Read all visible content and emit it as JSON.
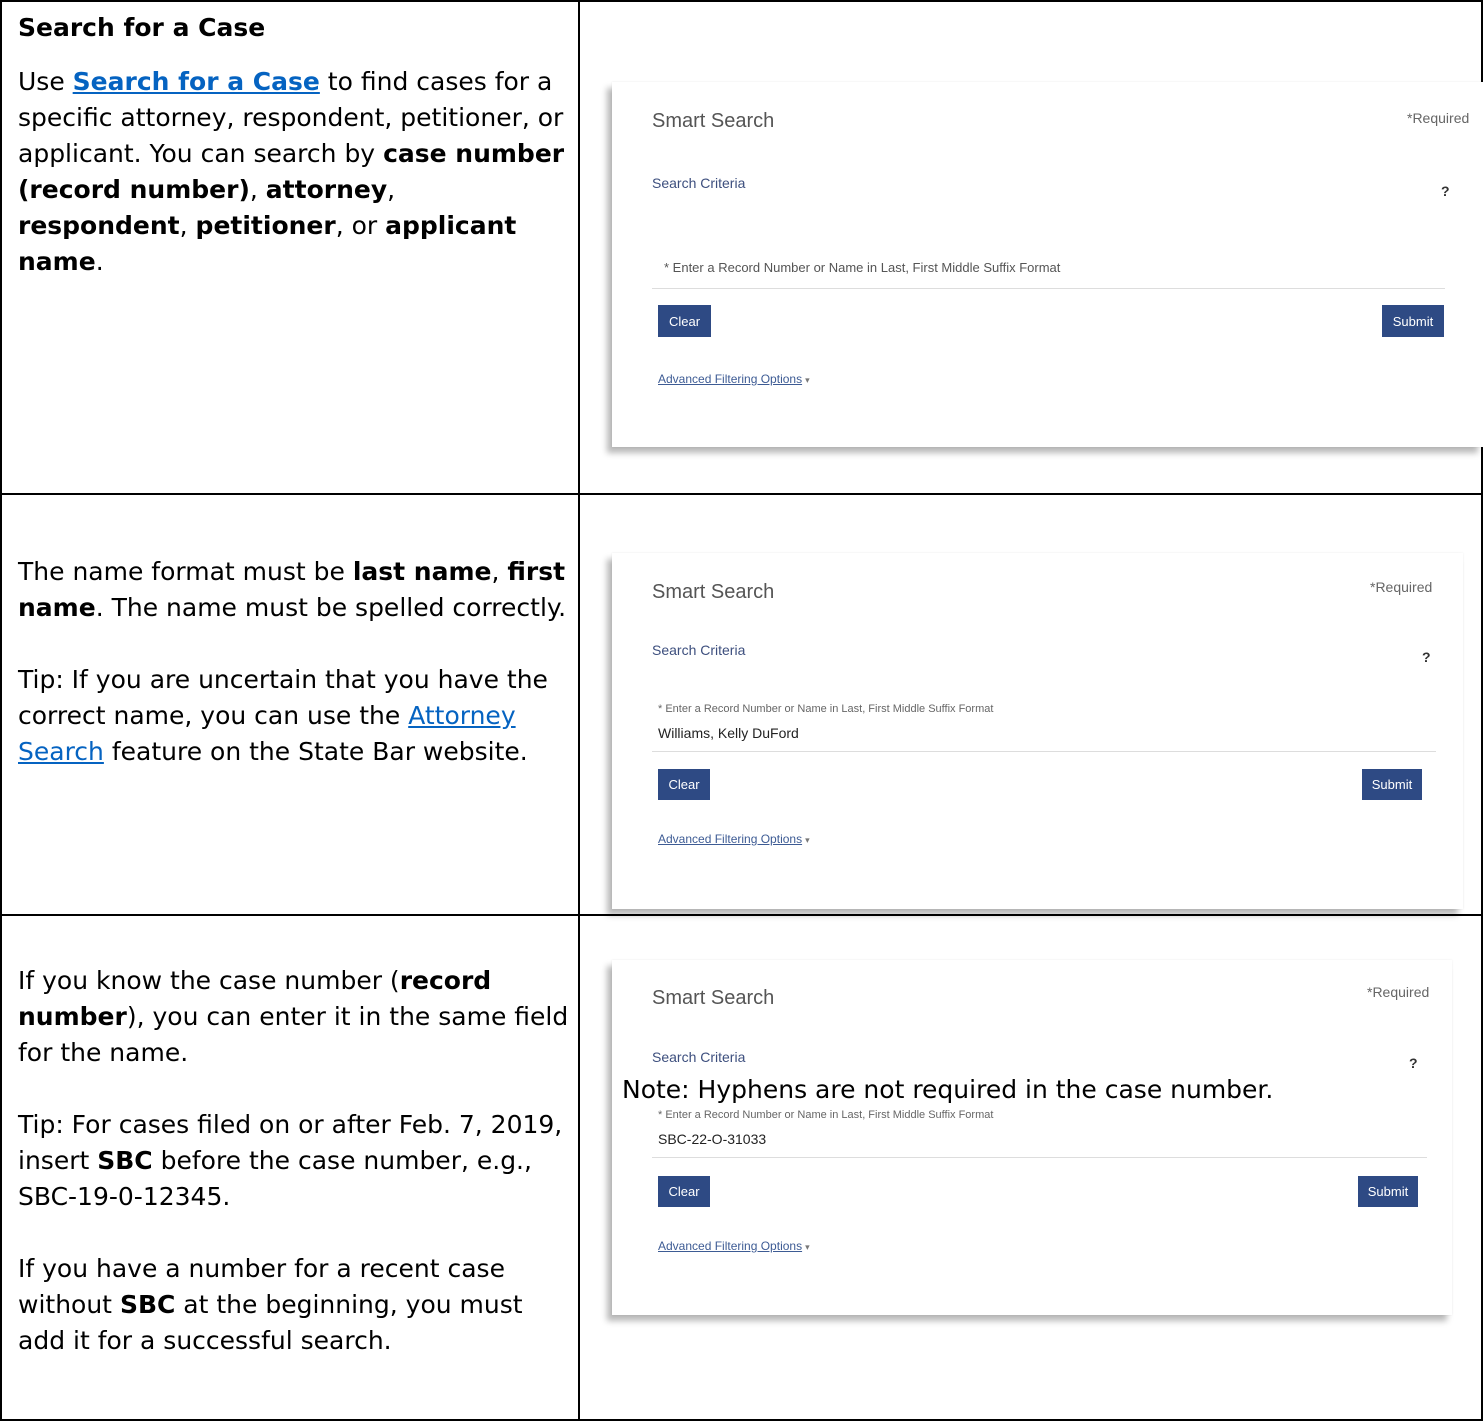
{
  "section1": {
    "heading": "Search for a Case",
    "p1_pre": "Use ",
    "p1_link": "Search for a Case",
    "p1_mid": " to find cases for a specific attorney, respondent, petitioner, or applicant. You can search by ",
    "p1_b1": "case number (record number)",
    "p1_s1": ", ",
    "p1_b2": "attorney",
    "p1_s2": ", ",
    "p1_b3": "respondent",
    "p1_s3": ", ",
    "p1_b4": "petitioner",
    "p1_s4": ", or ",
    "p1_b5": "applicant name",
    "p1_end": "."
  },
  "section2": {
    "p1_pre": "The name format must be ",
    "p1_b1": "last name",
    "p1_s1": ", ",
    "p1_b2": "first name",
    "p1_end": ". The name must be spelled correctly.",
    "tip_pre": "Tip: If you are uncertain that you have the correct name, you can use the ",
    "tip_link": "Attorney Search",
    "tip_end": " feature on the State Bar website."
  },
  "section3": {
    "p1_pre": "If you know the case number (",
    "p1_b1": "record number",
    "p1_end": "), you can enter it in the same field for the name.",
    "tip_pre": "Tip: For cases filed on or after Feb. 7, 2019, insert ",
    "tip_b": "SBC",
    "tip_end": " before the case number, e.g., SBC-19-0-12345.",
    "p3_pre": "If you have a number for a recent case without ",
    "p3_b": "SBC",
    "p3_end": " at the beginning, you must add it for a successful search.",
    "note": "Note: Hyphens are not required in the case number."
  },
  "smart_search": {
    "title": "Smart Search",
    "required": "*Required",
    "criteria": "Search Criteria",
    "help": "?",
    "placeholder": "* Enter a Record Number or Name in Last, First Middle Suffix Format",
    "clear": "Clear",
    "submit": "Submit",
    "advanced": "Advanced Filtering Options"
  },
  "panel2_value": "Williams, Kelly DuFord",
  "panel3_value": "SBC-22-O-31033"
}
